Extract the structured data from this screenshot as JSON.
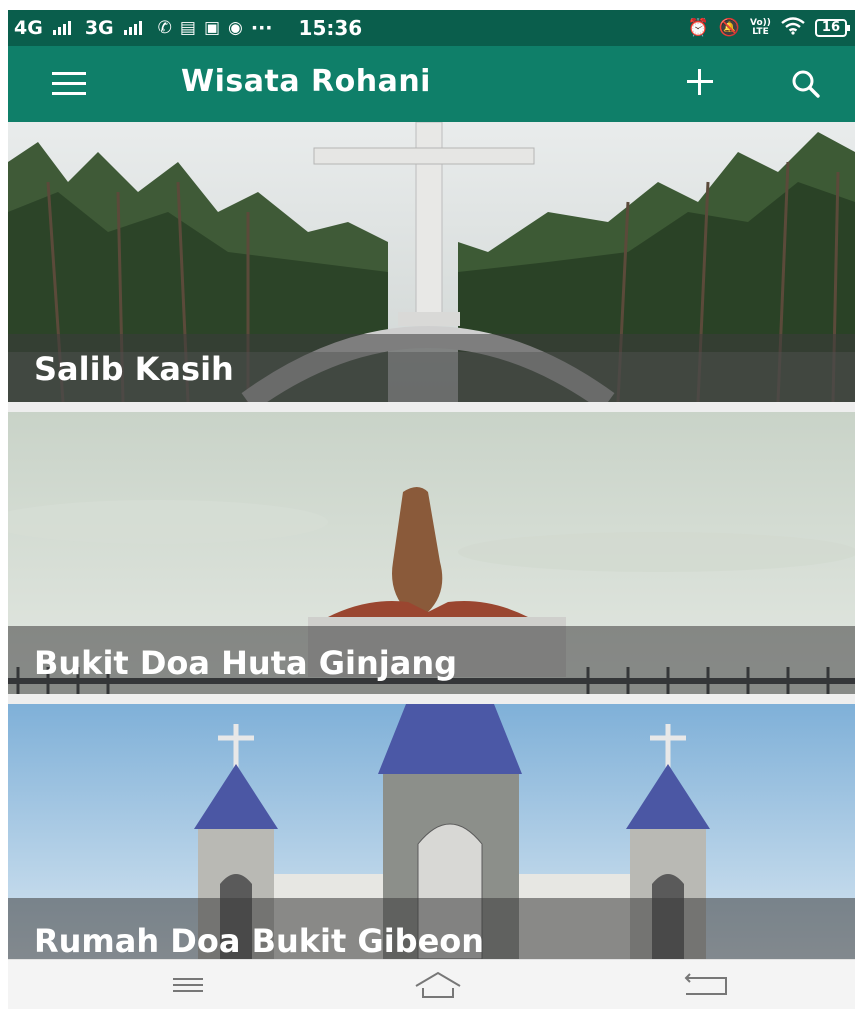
{
  "status_bar": {
    "network_1": "4G",
    "network_2": "3G",
    "more": "···",
    "time": "15:36",
    "volte_top": "Vo))",
    "volte_bottom": "LTE",
    "battery": "16"
  },
  "toolbar": {
    "title": "Wisata Rohani",
    "menu_icon": "hamburger-icon",
    "add_icon": "plus-icon",
    "search_icon": "search-icon",
    "color": "#0f7f69"
  },
  "places": [
    {
      "name": "Salib Kasih"
    },
    {
      "name": "Bukit Doa Huta Ginjang"
    },
    {
      "name": "Rumah Doa Bukit Gibeon"
    }
  ],
  "nav_bar": {
    "menu_icon": "menu-lines-icon",
    "home_icon": "home-icon",
    "back_icon": "back-icon"
  },
  "colors": {
    "status_bar": "#0a5e4c",
    "app_bar": "#0f7f69",
    "caption_overlay": "#3c3c3c"
  }
}
